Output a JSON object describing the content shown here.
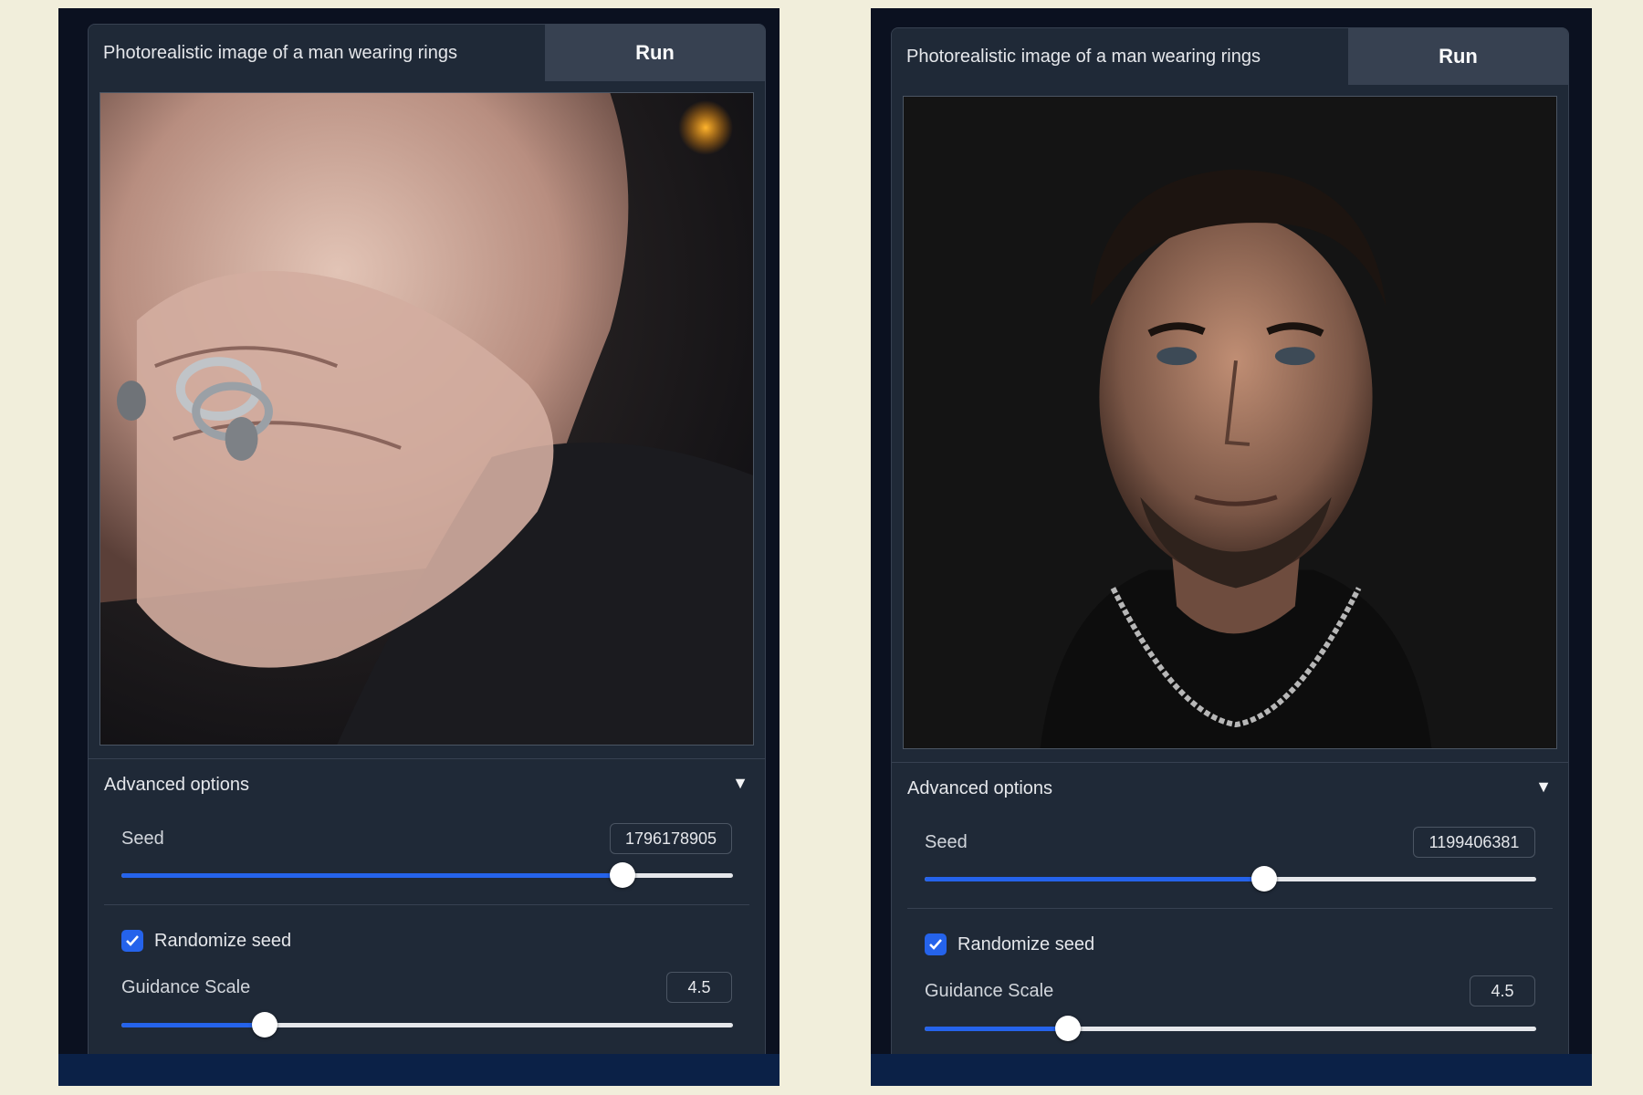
{
  "panels": [
    {
      "prompt": "Photorealistic image of a man wearing rings",
      "run_label": "Run",
      "image_description": "close-up of a man's hand with silver rings covering his mouth",
      "advanced_label": "Advanced options",
      "caret": "▼",
      "seed_label": "Seed",
      "seed_value": "1796178905",
      "seed_fraction": 0.82,
      "randomize_label": "Randomize seed",
      "randomize_checked": true,
      "guidance_label": "Guidance Scale",
      "guidance_value": "4.5",
      "guidance_fraction": 0.235
    },
    {
      "prompt": "Photorealistic image of a man wearing rings",
      "run_label": "Run",
      "image_description": "portrait of a bearded man in a dark shirt wearing a silver chain necklace",
      "advanced_label": "Advanced options",
      "caret": "▼",
      "seed_label": "Seed",
      "seed_value": "1199406381",
      "seed_fraction": 0.555,
      "randomize_label": "Randomize seed",
      "randomize_checked": true,
      "guidance_label": "Guidance Scale",
      "guidance_value": "4.5",
      "guidance_fraction": 0.235
    }
  ],
  "colors": {
    "page_bg": "#f1eedb",
    "panel_bg": "#0b1120",
    "card_bg": "#1f2937",
    "accent": "#2563eb",
    "footer": "#0b2147"
  }
}
